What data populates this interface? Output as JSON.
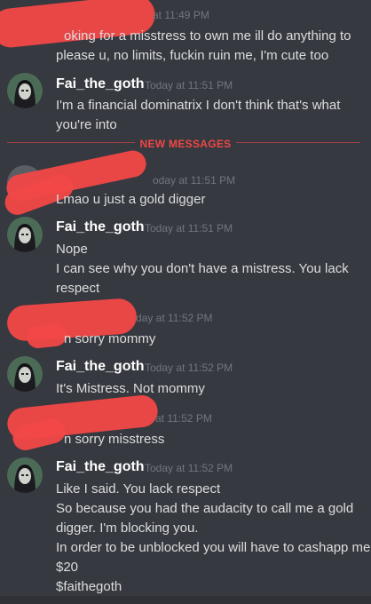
{
  "messages": [
    {
      "id": "m1",
      "author": "",
      "timestamp": "at 11:49 PM",
      "lines": [
        "oking for a misstress to own me ill do anything to",
        "please u, no limits, fuckin ruin me, I'm cute too"
      ]
    },
    {
      "id": "m2",
      "author": "Fai_the_goth",
      "timestamp": "Today at 11:51 PM",
      "lines": [
        "I'm a financial dominatrix I don't think that's what",
        "you're into"
      ]
    },
    {
      "id": "m3",
      "author": "",
      "timestamp": "oday at 11:51 PM",
      "lines": [
        "Lmao u just a gold digger"
      ]
    },
    {
      "id": "m4",
      "author": "Fai_the_goth",
      "timestamp": "Today at 11:51 PM",
      "lines": [
        "Nope",
        "I can see why you don't have a mistress. You lack",
        "respect"
      ]
    },
    {
      "id": "m5",
      "author": "",
      "timestamp": "day at 11:52 PM",
      "lines": [
        "n sorry mommy"
      ]
    },
    {
      "id": "m6",
      "author": "Fai_the_goth",
      "timestamp": "Today at 11:52 PM",
      "lines": [
        "It's Mistress. Not mommy"
      ]
    },
    {
      "id": "m7",
      "author": "",
      "timestamp": "at 11:52 PM",
      "lines": [
        "n sorry misstress"
      ]
    },
    {
      "id": "m8",
      "author": "Fai_the_goth",
      "timestamp": "Today at 11:52 PM",
      "lines": [
        "Like I said. You lack respect",
        "So because you had the audacity to call me a gold",
        "digger. I'm blocking you.",
        "In order to be unblocked you will have to cashapp me",
        "$20",
        "$faithegoth"
      ]
    }
  ],
  "divider": {
    "label": "NEW MESSAGES"
  },
  "colors": {
    "background": "#36393f",
    "redaction": "#f04747",
    "username": "#ffffff",
    "timestamp": "#72767d",
    "text": "#dcddde"
  }
}
